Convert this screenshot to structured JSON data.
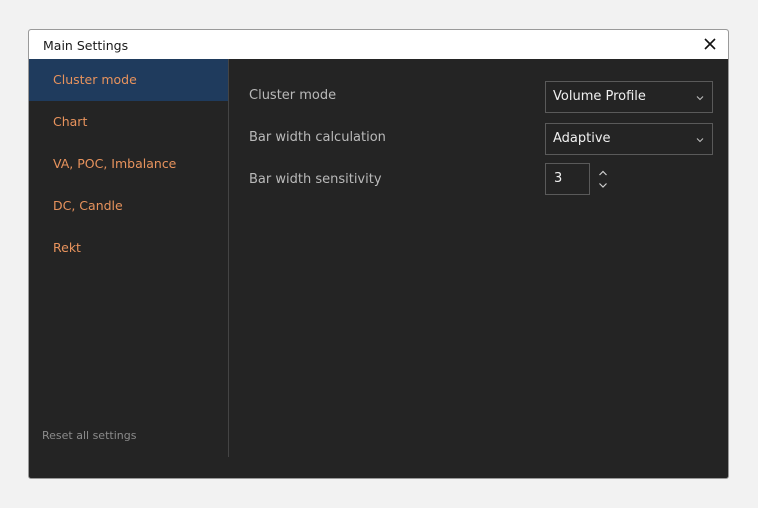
{
  "dialog": {
    "title": "Main Settings",
    "close_icon": "close-icon"
  },
  "sidebar": {
    "items": [
      {
        "label": "Cluster mode",
        "active": true
      },
      {
        "label": "Chart",
        "active": false
      },
      {
        "label": "VA, POC, Imbalance",
        "active": false
      },
      {
        "label": "DC, Candle",
        "active": false
      },
      {
        "label": "Rekt",
        "active": false
      }
    ],
    "reset_label": "Reset all settings"
  },
  "settings": {
    "cluster_mode": {
      "label": "Cluster mode",
      "value": "Volume Profile"
    },
    "bar_width_calculation": {
      "label": "Bar width calculation",
      "value": "Adaptive"
    },
    "bar_width_sensitivity": {
      "label": "Bar width sensitivity",
      "value": "3"
    }
  },
  "colors": {
    "panel_bg": "#242424",
    "accent_orange": "#e8935d",
    "active_item_bg": "#1f3b5d"
  }
}
